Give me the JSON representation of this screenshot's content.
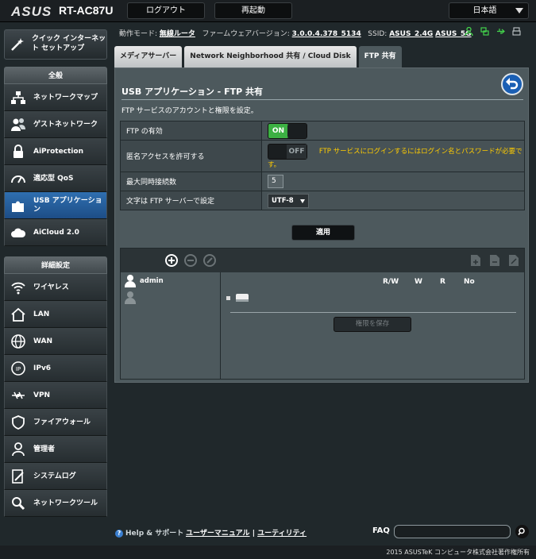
{
  "header": {
    "brand": "ASUS",
    "model": "RT-AC87U",
    "logout_label": "ログアウト",
    "reboot_label": "再起動",
    "language": "日本語"
  },
  "status": {
    "mode_label": "動作モード:",
    "mode_value": "無線ルータ",
    "firmware_label": "ファームウェアバージョン:",
    "firmware_value": "3.0.0.4.378_5134",
    "ssid_label": "SSID:",
    "ssid_1": "ASUS_2.4G",
    "ssid_2": "ASUS_5G"
  },
  "sidebar": {
    "qis_label": "クイック インターネット セットアップ",
    "general_header": "全般",
    "general_items": [
      {
        "label": "ネットワークマップ"
      },
      {
        "label": "ゲストネットワーク"
      },
      {
        "label": "AiProtection"
      },
      {
        "label": "適応型 QoS"
      },
      {
        "label": "USB アプリケーション"
      },
      {
        "label": "AiCloud 2.0"
      }
    ],
    "advanced_header": "詳細設定",
    "advanced_items": [
      {
        "label": "ワイヤレス"
      },
      {
        "label": "LAN"
      },
      {
        "label": "WAN"
      },
      {
        "label": "IPv6"
      },
      {
        "label": "VPN"
      },
      {
        "label": "ファイアウォール"
      },
      {
        "label": "管理者"
      },
      {
        "label": "システムログ"
      },
      {
        "label": "ネットワークツール"
      }
    ]
  },
  "tabs": [
    {
      "label": "メディアサーバー"
    },
    {
      "label": "Network Neighborhood 共有 / Cloud Disk"
    },
    {
      "label": "FTP 共有"
    }
  ],
  "content": {
    "title": "USB アプリケーション - FTP 共有",
    "description": "FTP サービスのアカウントと権限を設定。",
    "rows": {
      "ftp_enable": {
        "label": "FTP の有効",
        "switch": "ON"
      },
      "anon": {
        "label": "匿名アクセスを許可する",
        "switch": "OFF",
        "warning": "FTP サービスにログインするにはログイン名とパスワードが必要です。"
      },
      "max_conn": {
        "label": "最大同時接続数",
        "value": "5"
      },
      "charset": {
        "label": "文字は FTP サーバーで設定",
        "value": "UTF-8"
      }
    },
    "apply_label": "適用",
    "user_name": "admin",
    "columns": [
      "R/W",
      "W",
      "R",
      "No"
    ],
    "save_label": "権限を保存"
  },
  "footer": {
    "help": "Help & サポート",
    "manual": "ユーザーマニュアル",
    "divider": "|",
    "utility": "ユーティリティ",
    "faq": "FAQ",
    "copyright": "2015 ASUSTeK コンピュータ株式会社著作権所有"
  }
}
